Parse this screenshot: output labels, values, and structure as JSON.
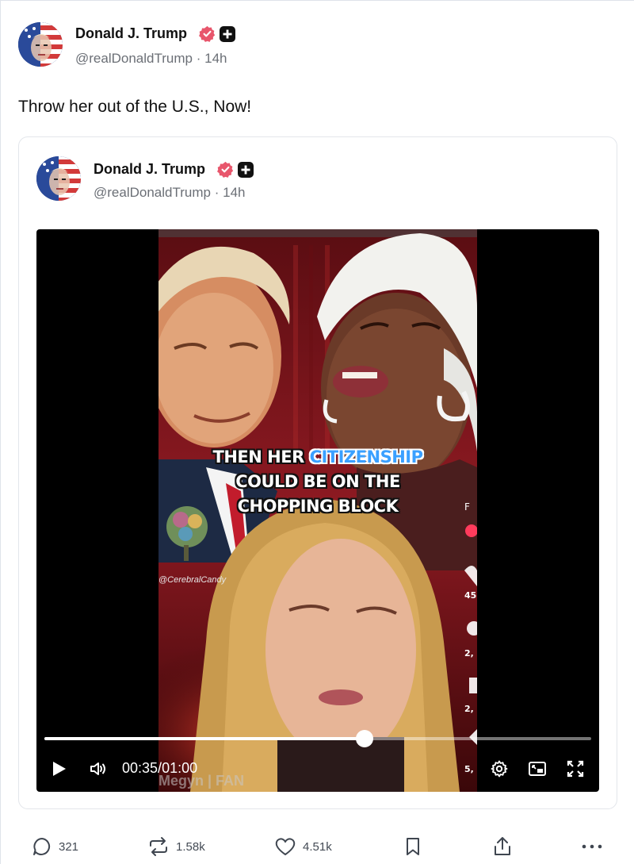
{
  "post": {
    "author_name": "Donald J. Trump",
    "handle": "@realDonaldTrump",
    "separator": "·",
    "time": "14h",
    "text": "Throw her out of the U.S., Now!"
  },
  "quoted": {
    "author_name": "Donald J. Trump",
    "handle": "@realDonaldTrump",
    "separator": "·",
    "time": "14h"
  },
  "video": {
    "caption_line1_pre": "THEN HER ",
    "caption_line1_highlight": "CITIZENSHIP",
    "caption_line2": "COULD BE ON THE",
    "caption_line3": "CHOPPING BLOCK",
    "watermark": "@CerebralCandy",
    "bottom_tag": "Megyn | FAN",
    "current_time": "00:35",
    "duration": "01:00",
    "time_sep": "/",
    "progress": 0.585
  },
  "actions": {
    "replies": "321",
    "reposts": "1.58k",
    "likes": "4.51k"
  },
  "colors": {
    "verified_badge": "#e8566c",
    "text_primary": "#111111",
    "text_secondary": "#6b6f76"
  },
  "icons": [
    "verified-badge-icon",
    "plus-member-icon",
    "play-icon",
    "volume-icon",
    "settings-icon",
    "pip-icon",
    "fullscreen-icon",
    "reply-icon",
    "repost-icon",
    "like-icon",
    "bookmark-icon",
    "share-icon",
    "more-icon"
  ]
}
